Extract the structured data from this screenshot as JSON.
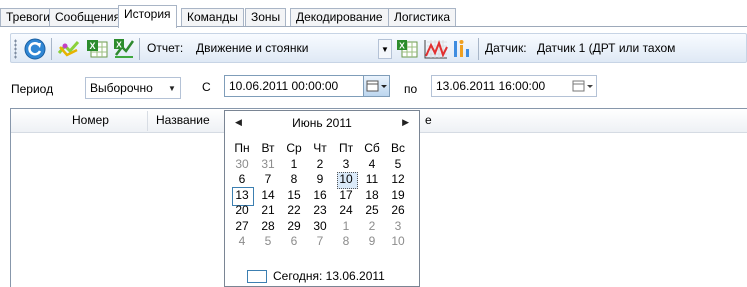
{
  "tabs": [
    {
      "label": "Тревоги",
      "active": false
    },
    {
      "label": "Сообщения",
      "active": false
    },
    {
      "label": "История",
      "active": true
    },
    {
      "label": "Команды",
      "active": false
    },
    {
      "label": "Зоны",
      "active": false
    },
    {
      "label": "Декодирование",
      "active": false
    },
    {
      "label": "Логистика",
      "active": false
    }
  ],
  "toolbar": {
    "report_label": "Отчет:",
    "report_value": "Движение и стоянки",
    "sensor_label": "Датчик:",
    "sensor_value": "Датчик 1 (ДРТ или тахом"
  },
  "filter": {
    "period_label": "Период",
    "period_value": "Выборочно",
    "from_label": "С",
    "from_value": "10.06.2011 00:00:00",
    "to_label": "по",
    "to_value": "13.06.2011 16:00:00"
  },
  "grid": {
    "columns": [
      "Номер",
      "Название"
    ],
    "partial_label": "е"
  },
  "calendar": {
    "month_title": "Июнь 2011",
    "weekdays": [
      "Пн",
      "Вт",
      "Ср",
      "Чт",
      "Пт",
      "Сб",
      "Вс"
    ],
    "weeks": [
      [
        "30",
        "31",
        "1",
        "2",
        "3",
        "4",
        "5"
      ],
      [
        "6",
        "7",
        "8",
        "9",
        "10",
        "11",
        "12"
      ],
      [
        "13",
        "14",
        "15",
        "16",
        "17",
        "18",
        "19"
      ],
      [
        "20",
        "21",
        "22",
        "23",
        "24",
        "25",
        "26"
      ],
      [
        "27",
        "28",
        "29",
        "30",
        "1",
        "2",
        "3"
      ],
      [
        "4",
        "5",
        "6",
        "7",
        "8",
        "9",
        "10"
      ]
    ],
    "selected_day": "10",
    "today_day": "13",
    "today_label": "Сегодня: 13.06.2011"
  },
  "colors": {
    "accent": "#3c7fb1",
    "tab_border": "#a9b5c6",
    "toolbar_bg": "#dfe9f5"
  }
}
